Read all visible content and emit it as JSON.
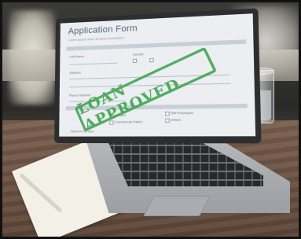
{
  "form": {
    "title": "Application Form",
    "subtitle": "Lorem ipsum dolor sit amet consectetur",
    "fields": [
      "Full Name",
      "Gender",
      "Address",
      "Phone Number",
      "Married",
      "Self Employed",
      "Commercial Rated",
      "Others",
      "Years in Service"
    ]
  },
  "stamp": {
    "text": "LOAN APPROVED",
    "color": "#3aa24a"
  },
  "colors": {
    "frame": "#111111",
    "screen": "#eceef2",
    "table": "#6b5242"
  }
}
